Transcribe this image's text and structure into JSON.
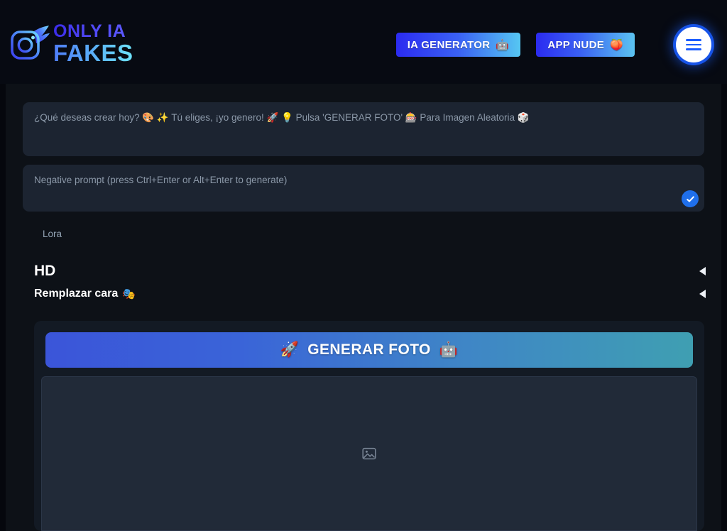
{
  "header": {
    "brand": {
      "logo_icon": "instagram-camera-wing-icon",
      "line1": "ONLY IA",
      "line2": "FAKES",
      "line1_color": "#4f46f5",
      "line2_color": "#5bb4f7"
    },
    "nav_buttons": [
      {
        "label": "IA GENERATOR",
        "emoji": "🤖",
        "emoji_name": "robot-icon",
        "gradient_from": "#2b2bf0",
        "gradient_to": "#56c7f2"
      },
      {
        "label": "APP NUDE",
        "emoji": "🍑",
        "emoji_name": "peach-icon",
        "gradient_from": "#2b2bf0",
        "gradient_to": "#5bc3f0"
      }
    ],
    "menu_button": {
      "icon": "hamburger-menu-icon",
      "accent": "#1a5cff"
    }
  },
  "main": {
    "prompt": {
      "value": "",
      "placeholder": "¿Qué deseas crear hoy? 🎨 ✨ Tú eliges, ¡yo genero! 🚀 💡 Pulsa 'GENERAR FOTO' 🎰 Para Imagen Aleatoria 🎲"
    },
    "negative_prompt": {
      "value": "",
      "placeholder": "Negative prompt (press Ctrl+Enter or Alt+Enter to generate)",
      "confirm_icon": "check-icon",
      "confirm_color": "#1f6feb"
    },
    "tabs": [
      {
        "label": "Lora",
        "selected": true
      }
    ],
    "accordions": [
      {
        "label": "HD",
        "emoji": "",
        "expanded": false,
        "arrow": "caret-left-icon"
      },
      {
        "label": "Remplazar cara",
        "emoji": "🎭",
        "emoji_name": "performing-arts-masks-icon",
        "expanded": false,
        "arrow": "caret-left-icon"
      }
    ],
    "generate_button": {
      "label": "GENERAR FOTO",
      "emoji_left": "🚀",
      "emoji_left_name": "rocket-icon",
      "emoji_right": "🤖",
      "emoji_right_name": "robot-icon",
      "gradient_from": "#3b55d9",
      "gradient_to": "#3f9fb2"
    },
    "preview": {
      "placeholder_icon": "image-placeholder-icon",
      "empty": true
    }
  },
  "colors": {
    "header_bg": "#070a12",
    "page_bg": "#0d1117",
    "field_bg": "#1c2431",
    "card_bg": "#131a24",
    "preview_bg": "#212a38",
    "muted_text": "#8b98a8"
  }
}
